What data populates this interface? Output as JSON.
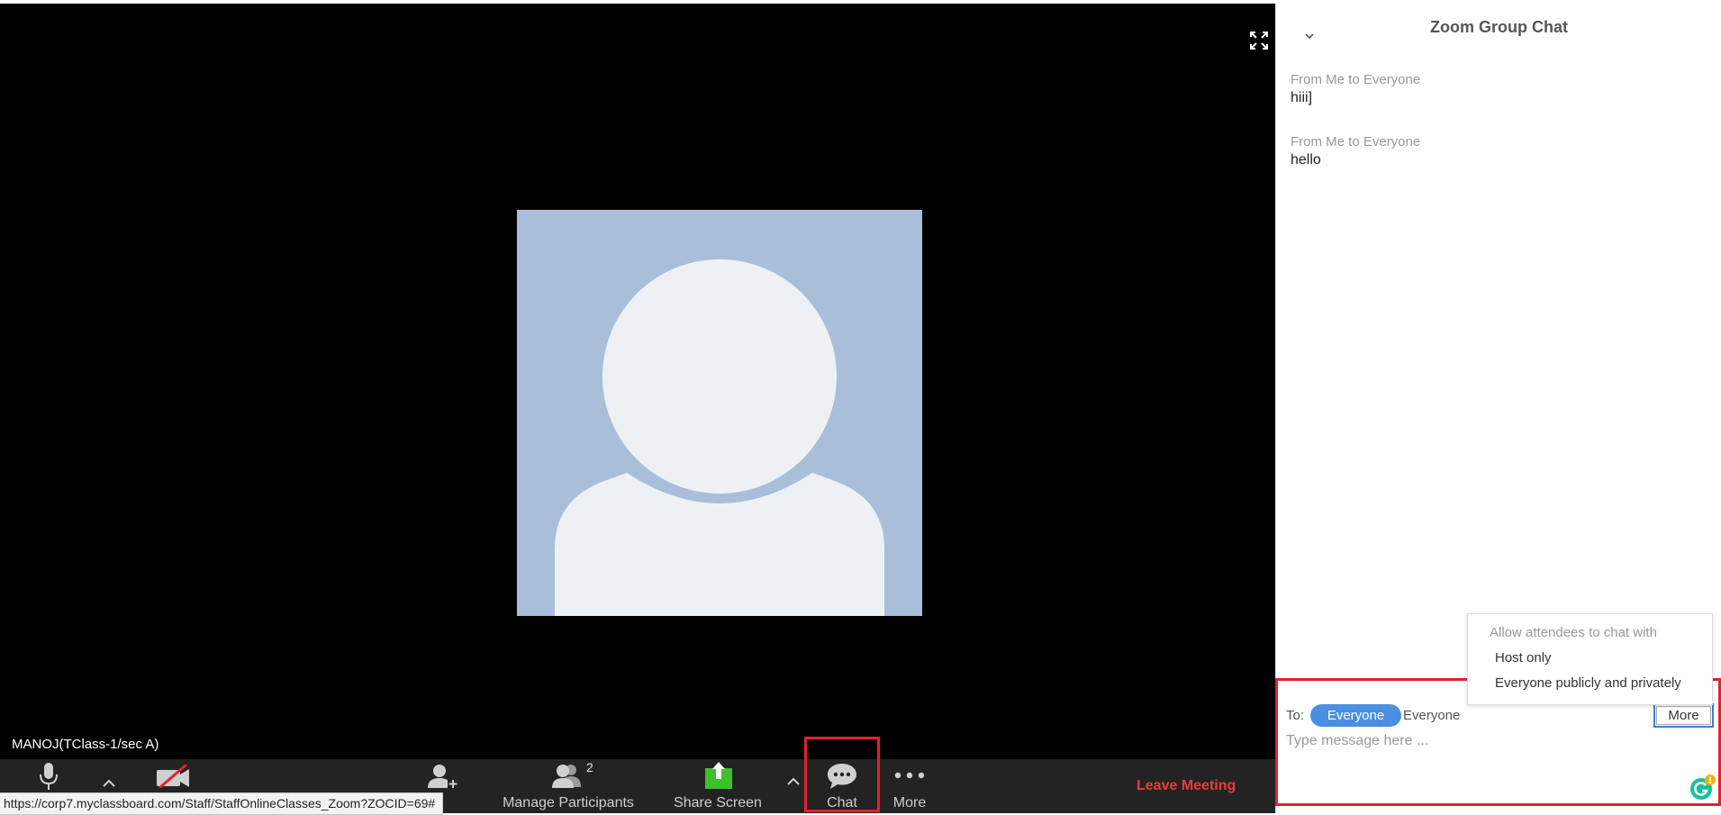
{
  "status_url": "https://corp7.myclassboard.com/Staff/StaffOnlineClasses_Zoom?ZOCID=69#",
  "video": {
    "participant_name": "MANOJ(TClass-1/sec A)"
  },
  "toolbar": {
    "participants_count": "2",
    "manage_participants_label": "Manage Participants",
    "share_screen_label": "Share Screen",
    "chat_label": "Chat",
    "more_label": "More",
    "leave_label": "Leave Meeting"
  },
  "chat": {
    "title": "Zoom Group Chat",
    "messages": [
      {
        "from": "From Me to Everyone",
        "text": "hiii]"
      },
      {
        "from": "From Me to Everyone",
        "text": "hello"
      }
    ],
    "popup": {
      "header": "Allow attendees to chat with",
      "options": [
        "Host only",
        "Everyone publicly and privately"
      ]
    },
    "to_label": "To:",
    "to_pill": "Everyone",
    "to_value": "Everyone",
    "more_button": "More",
    "input_placeholder": "Type message here ..."
  },
  "colors": {
    "accent": "#4a8fe2",
    "highlight": "#e3202d",
    "share_green": "#3fbf2a",
    "leave_red": "#f0383e"
  }
}
